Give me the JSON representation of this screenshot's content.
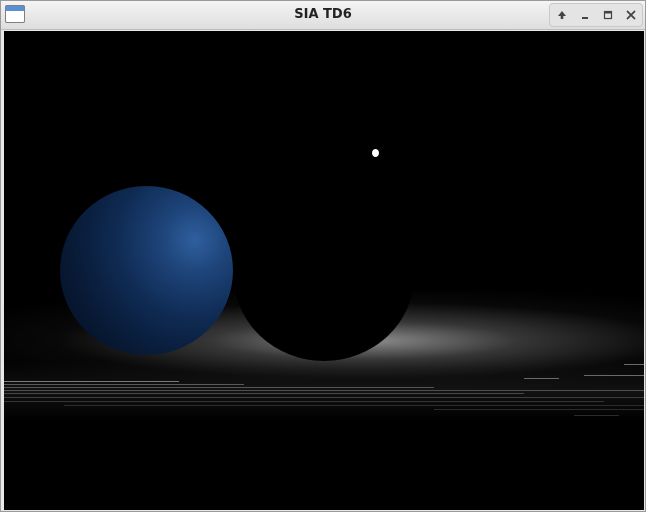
{
  "window": {
    "title": "SIA TD6",
    "controls": {
      "shade": "arrow-up-icon",
      "minimize": "minimize-icon",
      "maximize": "maximize-icon",
      "close": "close-icon"
    }
  },
  "scene": {
    "background_color": "#000000",
    "blue_sphere_color": "#1d4378",
    "light_color": "#ffffff"
  }
}
